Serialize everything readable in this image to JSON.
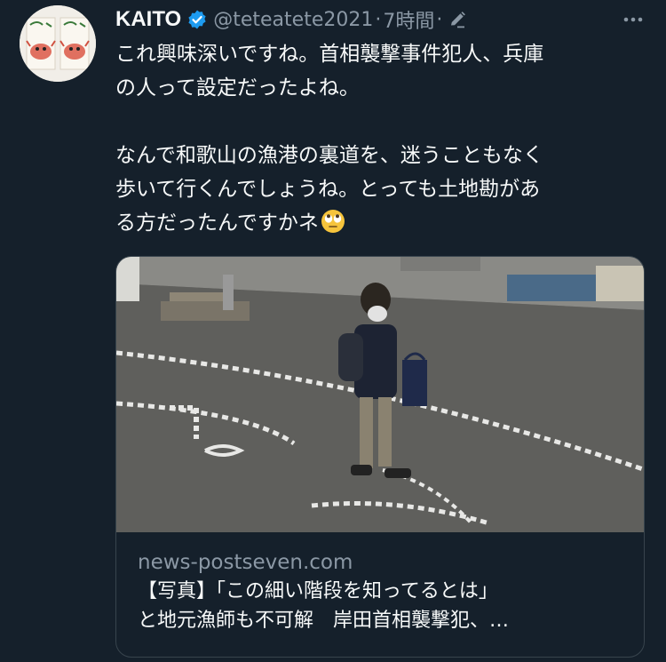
{
  "tweet": {
    "author_name": "KAITO",
    "handle": "@teteatete2021",
    "separator": "·",
    "time": "7時間",
    "separator2": "·",
    "text_para1": "これ興味深いですね。首相襲撃事件犯人、兵庫\nの人って設定だったよね。",
    "text_para2": "なんで和歌山の漁港の裏道を、迷うこともなく\n歩いて行くんでしょうね。とっても土地勘があ\nる方だったんですかネ",
    "emoji": "face-with-rolling-eyes"
  },
  "card": {
    "domain": "news-postseven.com",
    "title": "【写真】「この細い階段を知ってるとは」\nと地元漁師も不可解　岸田首相襲撃犯、…"
  },
  "icons": {
    "verified": "verified-badge-icon",
    "edit": "pencil-edit-icon",
    "more": "more-options-icon"
  },
  "colors": {
    "background": "#15202b",
    "text_primary": "#f7f9f9",
    "text_secondary": "#8b98a5",
    "verified": "#1d9bf0",
    "border": "#38444d"
  }
}
